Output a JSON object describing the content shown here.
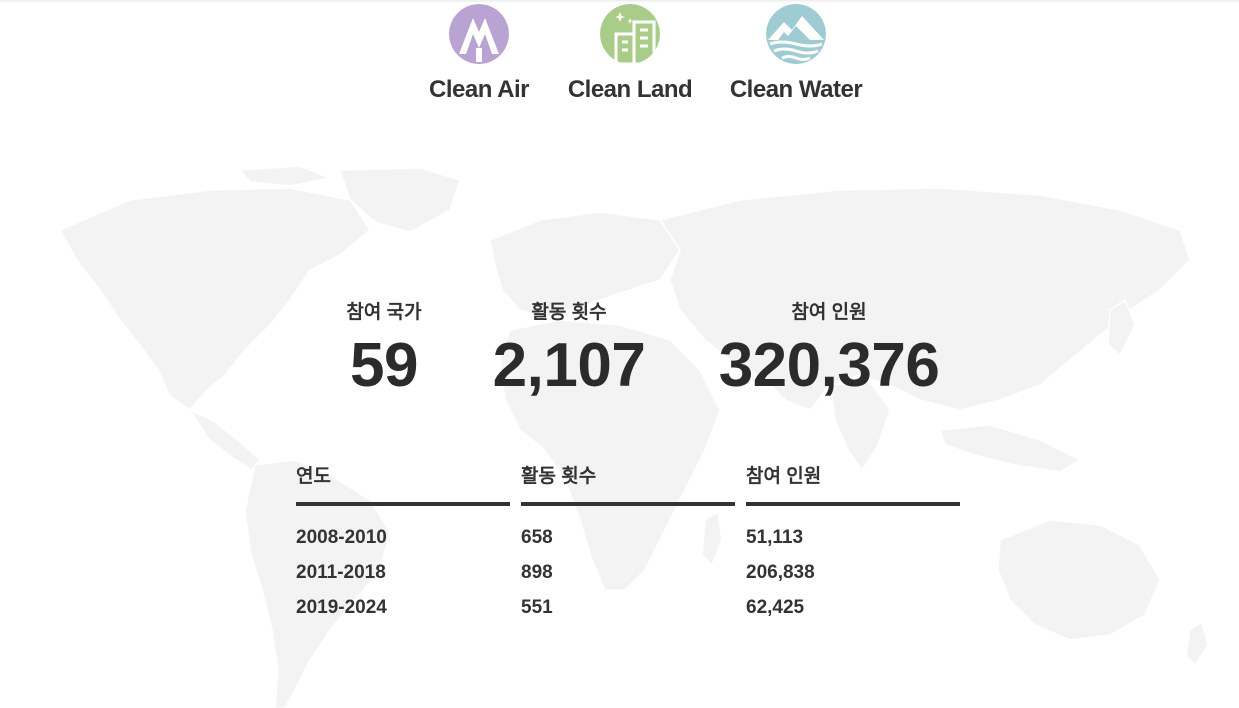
{
  "categories": [
    {
      "label": "Clean Air",
      "icon": "mountain-tree-icon",
      "color": "#b8a3d3"
    },
    {
      "label": "Clean Land",
      "icon": "building-icon",
      "color": "#a9cc89"
    },
    {
      "label": "Clean Water",
      "icon": "mountain-water-icon",
      "color": "#9fcbd2"
    }
  ],
  "stats": {
    "countries": {
      "label": "참여 국가",
      "value": "59"
    },
    "activities": {
      "label": "활동 횟수",
      "value": "2,107"
    },
    "participants": {
      "label": "참여 인원",
      "value": "320,376"
    }
  },
  "table": {
    "headers": [
      "연도",
      "활동 횟수",
      "참여 인원"
    ],
    "rows": [
      [
        "2008-2010",
        "658",
        "51,113"
      ],
      [
        "2011-2018",
        "898",
        "206,838"
      ],
      [
        "2019-2024",
        "551",
        "62,425"
      ]
    ]
  },
  "colors": {
    "text": "#2b2b2b",
    "map": "#f4f4f4",
    "rule": "#333333"
  }
}
